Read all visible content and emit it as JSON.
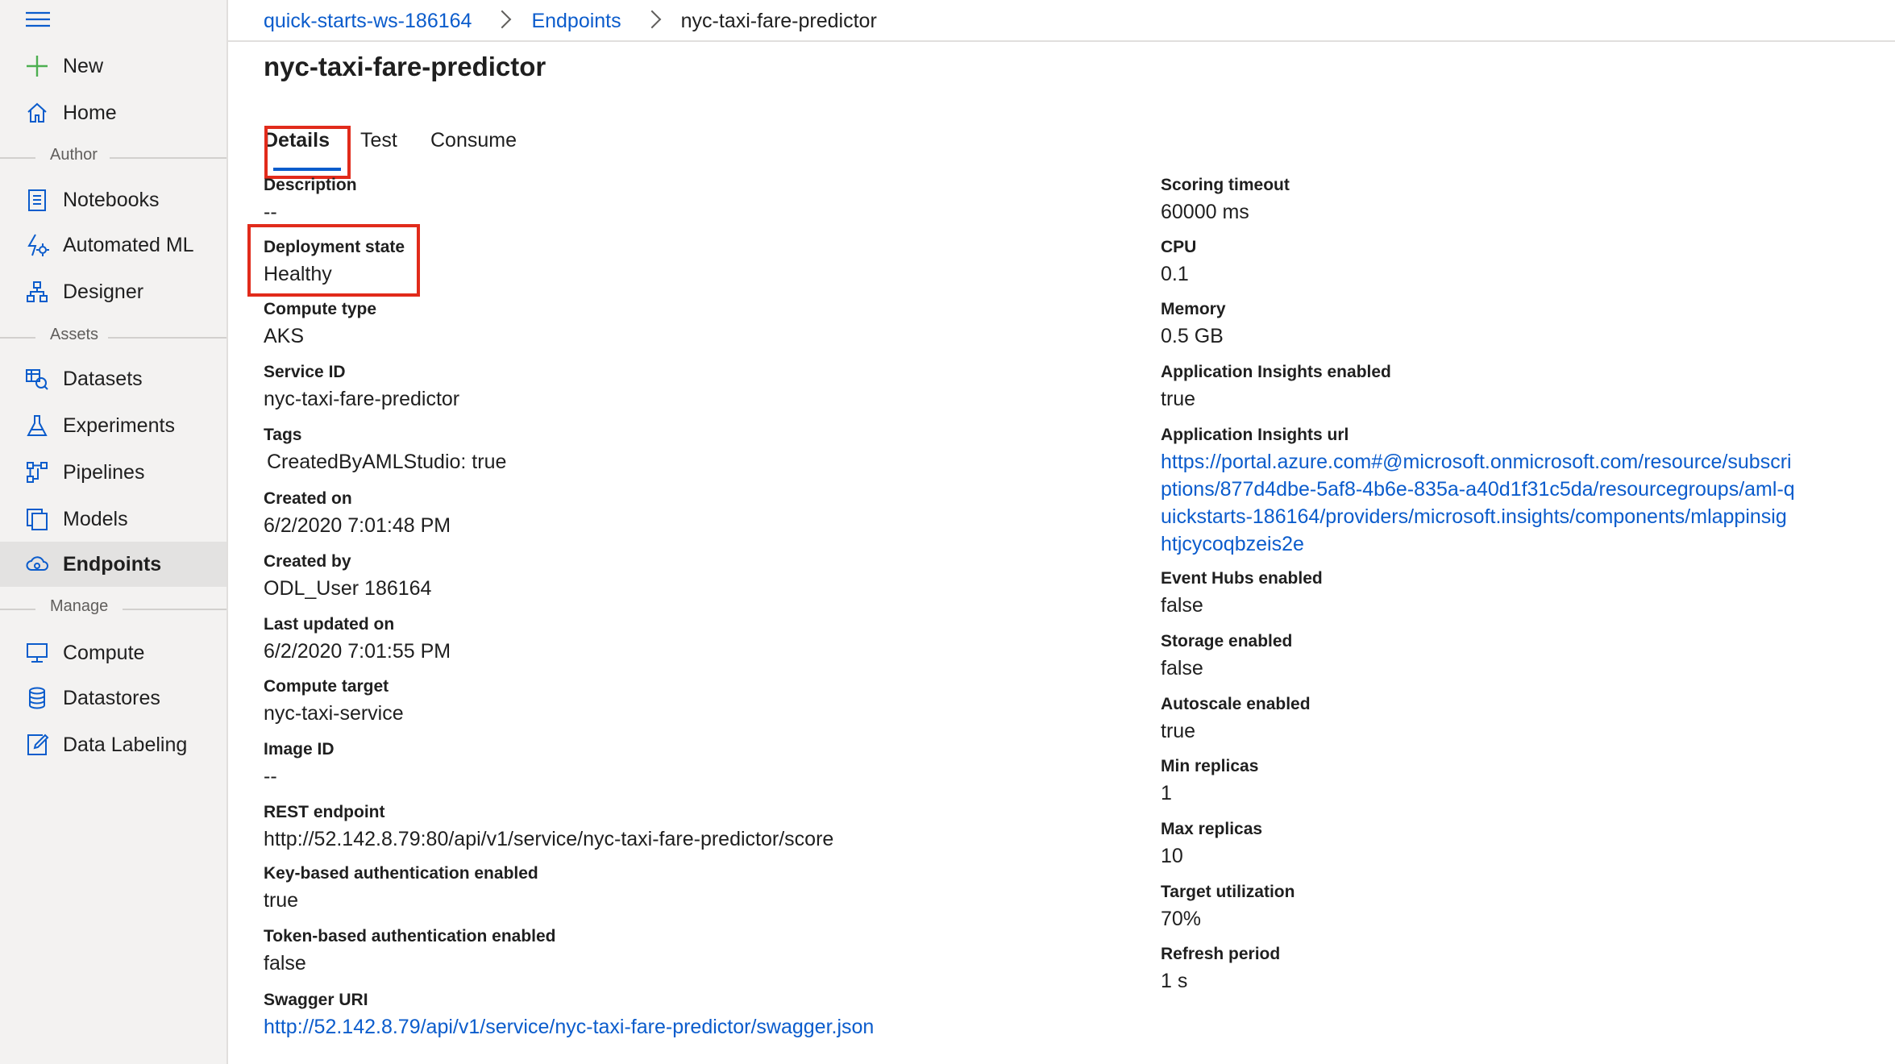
{
  "sidebar": {
    "new": "New",
    "home": "Home",
    "author_section": "Author",
    "notebooks": "Notebooks",
    "automated_ml": "Automated ML",
    "designer": "Designer",
    "assets_section": "Assets",
    "datasets": "Datasets",
    "experiments": "Experiments",
    "pipelines": "Pipelines",
    "models": "Models",
    "endpoints": "Endpoints",
    "manage_section": "Manage",
    "compute": "Compute",
    "datastores": "Datastores",
    "data_labeling": "Data Labeling",
    "active_item": "Endpoints"
  },
  "breadcrumb": {
    "workspace": "quick-starts-ws-186164",
    "endpoints": "Endpoints",
    "current": "nyc-taxi-fare-predictor"
  },
  "page": {
    "title": "nyc-taxi-fare-predictor"
  },
  "tabs": {
    "details": "Details",
    "test": "Test",
    "consume": "Consume",
    "active": "Details"
  },
  "left_fields": {
    "description": {
      "label": "Description",
      "value": "--"
    },
    "deployment_state": {
      "label": "Deployment state",
      "value": "Healthy"
    },
    "compute_type": {
      "label": "Compute type",
      "value": "AKS"
    },
    "service_id": {
      "label": "Service ID",
      "value": "nyc-taxi-fare-predictor"
    },
    "tags": {
      "label": "Tags",
      "value": "CreatedByAMLStudio: true"
    },
    "created_on": {
      "label": "Created on",
      "value": "6/2/2020 7:01:48 PM"
    },
    "created_by": {
      "label": "Created by",
      "value": "ODL_User 186164"
    },
    "last_updated_on": {
      "label": "Last updated on",
      "value": "6/2/2020 7:01:55 PM"
    },
    "compute_target": {
      "label": "Compute target",
      "value": "nyc-taxi-service"
    },
    "image_id": {
      "label": "Image ID",
      "value": "--"
    },
    "rest_endpoint": {
      "label": "REST endpoint",
      "value": "http://52.142.8.79:80/api/v1/service/nyc-taxi-fare-predictor/score"
    },
    "key_auth": {
      "label": "Key-based authentication enabled",
      "value": "true"
    },
    "token_auth": {
      "label": "Token-based authentication enabled",
      "value": "false"
    },
    "swagger_uri": {
      "label": "Swagger URI",
      "value": "http://52.142.8.79/api/v1/service/nyc-taxi-fare-predictor/swagger.json"
    }
  },
  "right_fields": {
    "scoring_timeout": {
      "label": "Scoring timeout",
      "value": "60000 ms"
    },
    "cpu": {
      "label": "CPU",
      "value": "0.1"
    },
    "memory": {
      "label": "Memory",
      "value": "0.5 GB"
    },
    "app_insights_enabled": {
      "label": "Application Insights enabled",
      "value": "true"
    },
    "app_insights_url": {
      "label": "Application Insights url",
      "lines": [
        "https://portal.azure.com#@microsoft.onmicrosoft.com/resource/subscri",
        "ptions/877d4dbe-5af8-4b6e-835a-a40d1f31c5da/resourcegroups/aml-q",
        "uickstarts-186164/providers/microsoft.insights/components/mlappinsig",
        "htjcycoqbzeis2e"
      ]
    },
    "event_hubs_enabled": {
      "label": "Event Hubs enabled",
      "value": "false"
    },
    "storage_enabled": {
      "label": "Storage enabled",
      "value": "false"
    },
    "autoscale_enabled": {
      "label": "Autoscale enabled",
      "value": "true"
    },
    "min_replicas": {
      "label": "Min replicas",
      "value": "1"
    },
    "max_replicas": {
      "label": "Max replicas",
      "value": "10"
    },
    "target_utilization": {
      "label": "Target utilization",
      "value": "70%"
    },
    "refresh_period": {
      "label": "Refresh period",
      "value": "1 s"
    }
  },
  "colors": {
    "link": "#0b5ccc",
    "highlight": "#e12b1b",
    "sidebar_bg": "#f3f2f1",
    "new_plus": "#4caf50"
  },
  "icons": {
    "hamburger": "hamburger-menu-icon",
    "new": "plus-icon",
    "home": "home-icon",
    "notebooks": "notebook-icon",
    "automated_ml": "automated-ml-icon",
    "designer": "designer-icon",
    "datasets": "dataset-icon",
    "experiments": "flask-icon",
    "pipelines": "pipeline-icon",
    "models": "model-icon",
    "endpoints": "endpoint-cloud-icon",
    "compute": "monitor-icon",
    "datastores": "database-icon",
    "data_labeling": "edit-icon"
  }
}
